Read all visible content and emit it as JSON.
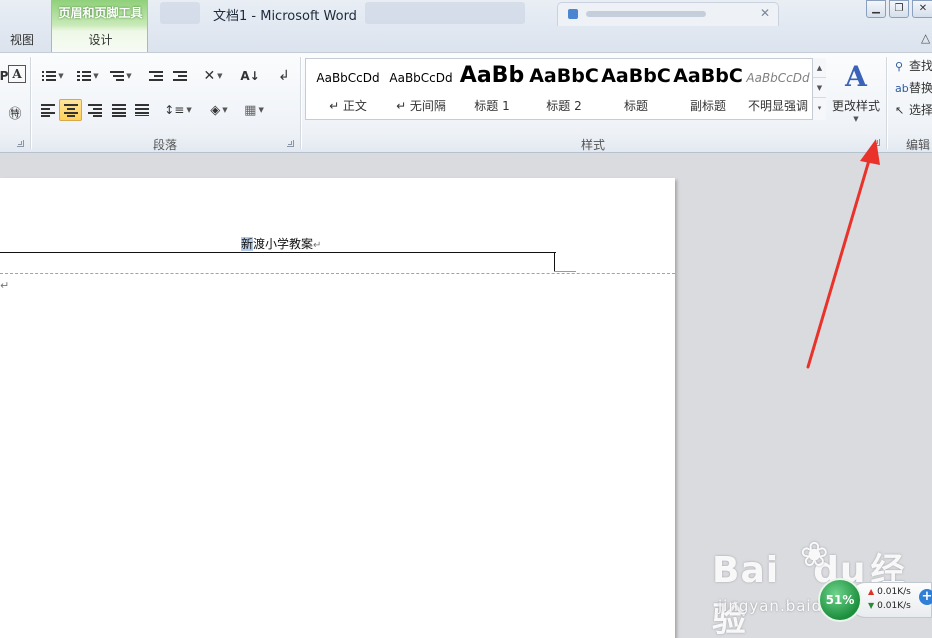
{
  "window": {
    "title": "文档1 - Microsoft Word",
    "context_tab_group": "页眉和页脚工具",
    "tabs": {
      "view": "视图",
      "design": "设计"
    }
  },
  "ribbon": {
    "groups": {
      "paragraph": "段落",
      "styles": "样式",
      "editing": "编辑"
    },
    "styles_gallery": [
      {
        "sample": "AaBbCcDd",
        "name": "↵ 正文",
        "sample_style": "normal",
        "color": "#000000"
      },
      {
        "sample": "AaBbCcDd",
        "name": "↵ 无间隔",
        "sample_style": "normal",
        "color": "#000000"
      },
      {
        "sample": "AaBb",
        "name": "标题 1",
        "sample_style": "heading1",
        "color": "#000000"
      },
      {
        "sample": "AaBbC",
        "name": "标题 2",
        "sample_style": "heading2",
        "color": "#000000"
      },
      {
        "sample": "AaBbC",
        "name": "标题",
        "sample_style": "heading2",
        "color": "#000000"
      },
      {
        "sample": "AaBbC",
        "name": "副标题",
        "sample_style": "heading2",
        "color": "#000000"
      },
      {
        "sample": "AaBbCcDd",
        "name": "不明显强调",
        "sample_style": "subtle",
        "color": "#808080"
      }
    ],
    "change_styles": "更改样式",
    "editing": {
      "find": "查找",
      "replace": "替换",
      "select": "选择"
    }
  },
  "document": {
    "header_selected": "新",
    "header_rest": "渡小学教案",
    "paragraph_mark": "↵"
  },
  "overlay": {
    "watermark_text": "Bai",
    "watermark_text2": "du",
    "watermark_cn": "经验",
    "watermark_url": "jingyan.baidu.com",
    "speed_percent": "51%",
    "upload_speed": "0.01K/s",
    "download_speed": "0.01K/s",
    "arrow_color": "#e8322a"
  }
}
